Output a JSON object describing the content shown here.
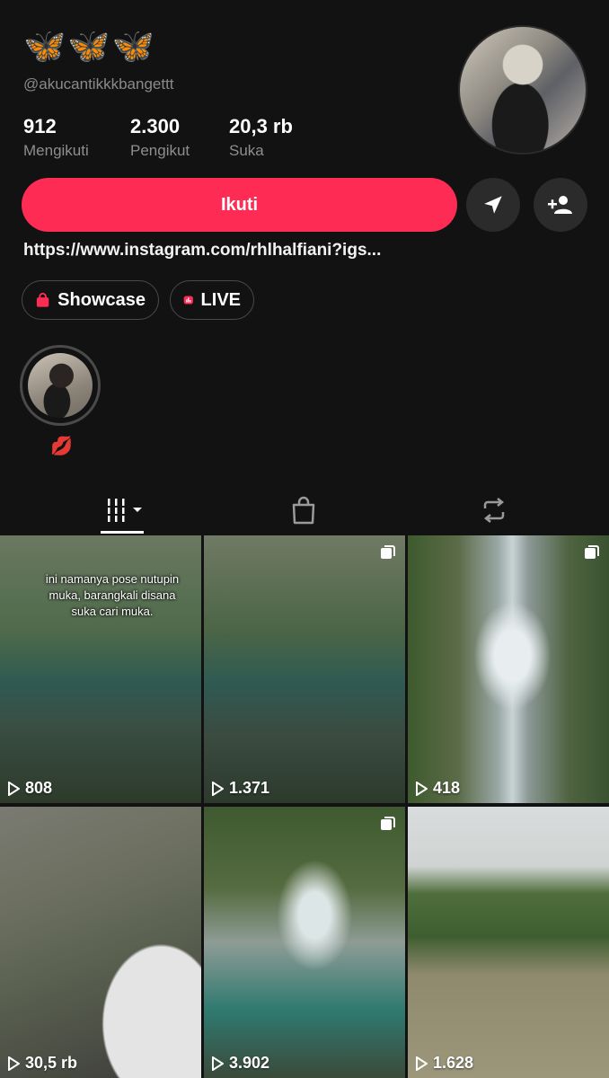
{
  "profile": {
    "title": "🦋🦋🦋",
    "handle": "@akucantikkkbangettt",
    "stats": [
      {
        "value": "912",
        "label": "Mengikuti"
      },
      {
        "value": "2.300",
        "label": "Pengikut"
      },
      {
        "value": "20,3 rb",
        "label": "Suka"
      }
    ],
    "follow_label": "Ikuti",
    "bio_link": "https://www.instagram.com/rhlhalfiani?igs...",
    "chips": [
      {
        "label": "Showcase",
        "icon": "shopping-bag-icon"
      },
      {
        "label": "LIVE",
        "icon": "live-icon"
      }
    ],
    "highlight_label": "💋"
  },
  "tabs": [
    {
      "name": "videos",
      "icon": "grid-icon"
    },
    {
      "name": "shop",
      "icon": "shopping-bag-icon"
    },
    {
      "name": "reposts",
      "icon": "repost-icon"
    }
  ],
  "videos": [
    {
      "views": "808",
      "overlay": "ini namanya pose nutupin muka, barangkali disana suka cari muka.",
      "multi": false
    },
    {
      "views": "1.371",
      "multi": true
    },
    {
      "views": "418",
      "multi": true
    },
    {
      "views": "30,5 rb",
      "multi": false
    },
    {
      "views": "3.902",
      "multi": true
    },
    {
      "views": "1.628",
      "multi": false
    }
  ],
  "colors": {
    "accent": "#fe2c55",
    "background": "#121212"
  }
}
